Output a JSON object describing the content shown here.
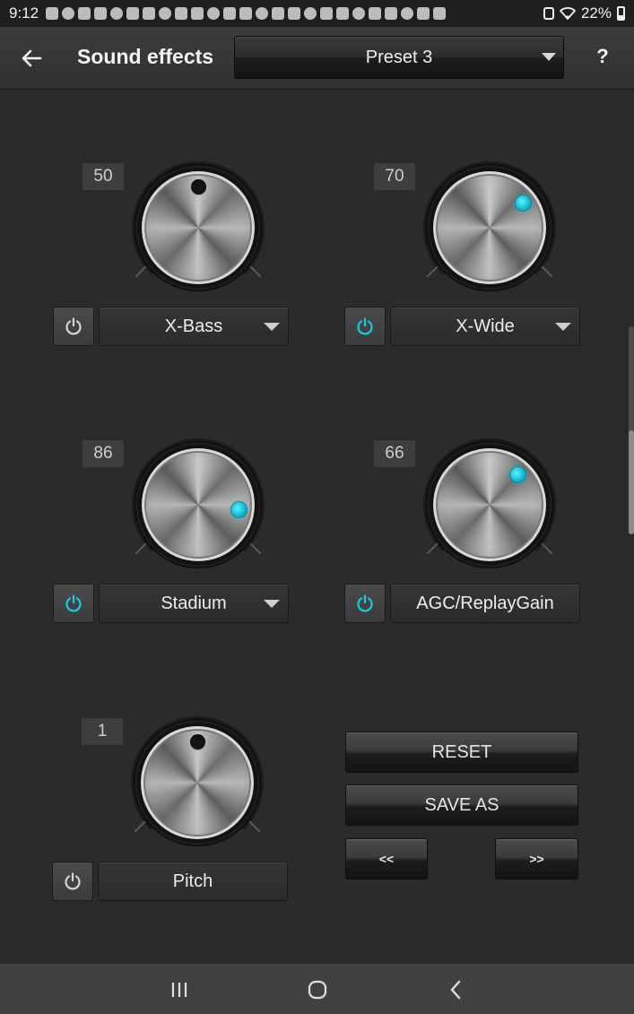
{
  "status_bar": {
    "time": "9:12",
    "battery": "22%",
    "notification_icons": [
      "app-icon",
      "app-icon",
      "app-icon",
      "app-icon",
      "app-icon",
      "facebook-icon",
      "facebook-icon",
      "facebook-icon",
      "youtube-icon",
      "youtube-icon",
      "email-icon",
      "twitter-icon",
      "app-icon",
      "app-icon",
      "app-icon",
      "app-icon",
      "messenger-icon",
      "tune-icon",
      "youtube-icon",
      "notification-icon",
      "messenger-icon",
      "google-icon",
      "app-icon",
      "download-icon",
      "cloud-icon"
    ]
  },
  "header": {
    "back_icon": "arrow-left-icon",
    "title": "Sound effects",
    "preset": "Preset 3",
    "help_label": "?"
  },
  "effects": [
    {
      "value": "50",
      "level": 50,
      "enabled": false,
      "label": "X-Bass",
      "has_dropdown": true
    },
    {
      "value": "70",
      "level": 70,
      "enabled": true,
      "label": "X-Wide",
      "has_dropdown": true
    },
    {
      "value": "86",
      "level": 86,
      "enabled": true,
      "label": "Stadium",
      "has_dropdown": true
    },
    {
      "value": "66",
      "level": 66,
      "enabled": true,
      "label": "AGC/ReplayGain",
      "has_dropdown": false
    },
    {
      "value": "1",
      "level": 50,
      "enabled": false,
      "label": "Pitch",
      "has_dropdown": false
    }
  ],
  "actions": {
    "reset": "RESET",
    "save_as": "SAVE AS",
    "prev": "<<",
    "next": ">>"
  },
  "colors": {
    "accent": "#1fc9e0",
    "background": "#2a2b2d",
    "header": "#333436"
  },
  "nav": {
    "recents_icon": "recents-icon",
    "home_icon": "home-icon",
    "back_icon": "back-icon"
  }
}
